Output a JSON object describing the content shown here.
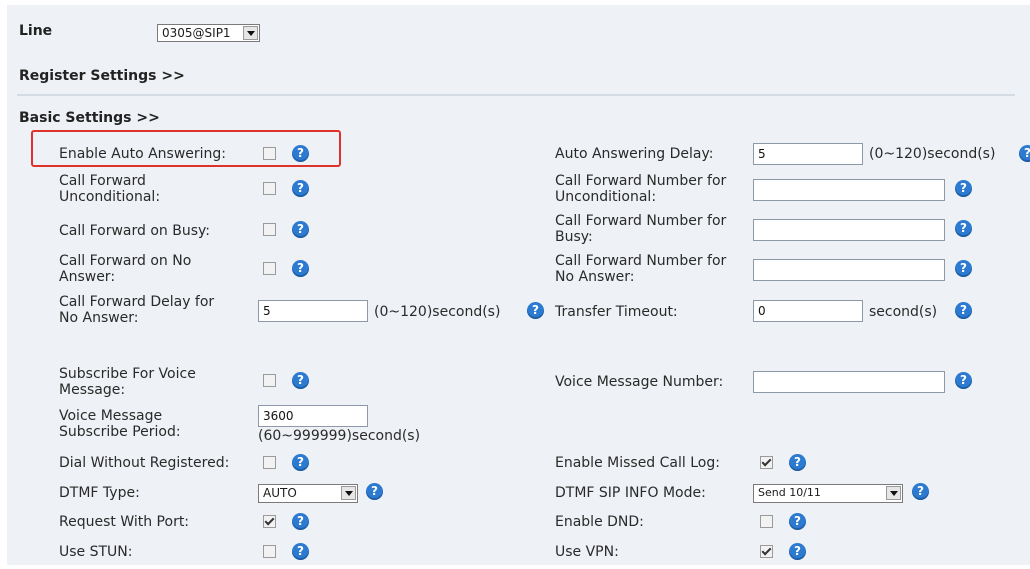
{
  "line": {
    "label": "Line",
    "value": "0305@SIP1"
  },
  "sections": {
    "register": "Register Settings >>",
    "basic": "Basic Settings >>"
  },
  "help_glyph": "?",
  "fields": {
    "auto_answering": {
      "label": "Enable Auto Answering:",
      "checked": false
    },
    "auto_answering_delay": {
      "label": "Auto Answering Delay:",
      "value": "5",
      "unit": "(0~120)second(s)"
    },
    "cf_unconditional": {
      "label1": "Call Forward",
      "label2": "Unconditional:",
      "checked": false
    },
    "cf_number_unconditional": {
      "label1": "Call Forward Number for",
      "label2": "Unconditional:",
      "value": ""
    },
    "cf_busy": {
      "label": "Call Forward on Busy:",
      "checked": false
    },
    "cf_number_busy": {
      "label1": "Call Forward Number for",
      "label2": "Busy:",
      "value": ""
    },
    "cf_no_answer": {
      "label1": "Call Forward on No",
      "label2": "Answer:",
      "checked": false
    },
    "cf_number_no_answer": {
      "label1": "Call Forward Number for",
      "label2": "No Answer:",
      "value": ""
    },
    "cf_delay": {
      "label1": "Call Forward Delay for",
      "label2": "No Answer:",
      "value": "5",
      "unit": "(0~120)second(s)"
    },
    "transfer_timeout": {
      "label": "Transfer Timeout:",
      "value": "0",
      "unit": "second(s)"
    },
    "subscribe_vm": {
      "label1": "Subscribe For Voice",
      "label2": "Message:",
      "checked": false
    },
    "vm_number": {
      "label": "Voice Message Number:",
      "value": ""
    },
    "vm_period": {
      "label1": "Voice Message",
      "label2": "Subscribe Period:",
      "value": "3600",
      "unit": "(60~999999)second(s)"
    },
    "dial_without_registered": {
      "label": "Dial Without Registered:",
      "checked": false
    },
    "missed_call_log": {
      "label": "Enable Missed Call Log:",
      "checked": true
    },
    "dtmf_type": {
      "label": "DTMF Type:",
      "value": "AUTO"
    },
    "dtmf_sip_info": {
      "label": "DTMF SIP INFO Mode:",
      "value": "Send 10/11"
    },
    "request_with_port": {
      "label": "Request With Port:",
      "checked": true
    },
    "enable_dnd": {
      "label": "Enable DND:",
      "checked": false
    },
    "use_stun": {
      "label": "Use STUN:",
      "checked": false
    },
    "use_vpn": {
      "label": "Use VPN:",
      "checked": true
    }
  }
}
